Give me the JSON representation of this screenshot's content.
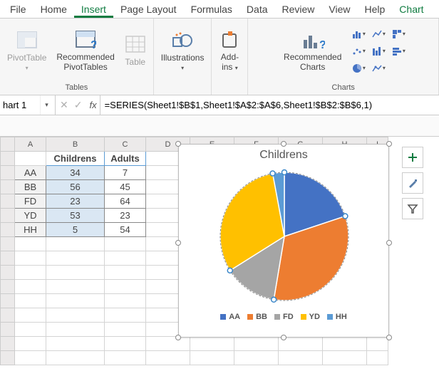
{
  "tabs": {
    "file": "File",
    "home": "Home",
    "insert": "Insert",
    "page": "Page Layout",
    "formulas": "Formulas",
    "data": "Data",
    "review": "Review",
    "view": "View",
    "help": "Help",
    "chart": "Chart"
  },
  "ribbon": {
    "pivot": "PivotTable",
    "recpivot_l1": "Recommended",
    "recpivot_l2": "PivotTables",
    "table": "Table",
    "group_tables": "Tables",
    "illus": "Illustrations",
    "addins_l1": "Add-",
    "addins_l2": "ins",
    "recchart_l1": "Recommended",
    "recchart_l2": "Charts",
    "group_charts": "Charts"
  },
  "name_box": "hart 1",
  "fx": "fx",
  "formula": "=SERIES(Sheet1!$B$1,Sheet1!$A$2:$A$6,Sheet1!$B$2:$B$6,1)",
  "cols": [
    "A",
    "B",
    "C",
    "D",
    "E",
    "F",
    "G",
    "H",
    "I"
  ],
  "rows": [
    "",
    "",
    "",
    "",
    "",
    "",
    "",
    "",
    "",
    "",
    "",
    "",
    "",
    "",
    ""
  ],
  "headers": {
    "b": "Childrens",
    "c": "Adults"
  },
  "data": {
    "r2": {
      "a": "AA",
      "b": "34",
      "c": "7"
    },
    "r3": {
      "a": "BB",
      "b": "56",
      "c": "45"
    },
    "r4": {
      "a": "FD",
      "b": "23",
      "c": "64"
    },
    "r5": {
      "a": "YD",
      "b": "53",
      "c": "23"
    },
    "r6": {
      "a": "HH",
      "b": "5",
      "c": "54"
    }
  },
  "chart": {
    "title": "Childrens",
    "legend": {
      "aa": "AA",
      "bb": "BB",
      "fd": "FD",
      "yd": "YD",
      "hh": "HH"
    }
  },
  "chart_data": {
    "type": "pie",
    "title": "Childrens",
    "categories": [
      "AA",
      "BB",
      "FD",
      "YD",
      "HH"
    ],
    "values": [
      34,
      56,
      23,
      53,
      5
    ],
    "colors": [
      "#4472c4",
      "#ed7d31",
      "#a5a5a5",
      "#ffc000",
      "#5b9bd5"
    ],
    "selected_series": 1
  },
  "colors": {
    "aa": "#4472c4",
    "bb": "#ed7d31",
    "fd": "#a5a5a5",
    "yd": "#ffc000",
    "hh": "#5b9bd5"
  }
}
